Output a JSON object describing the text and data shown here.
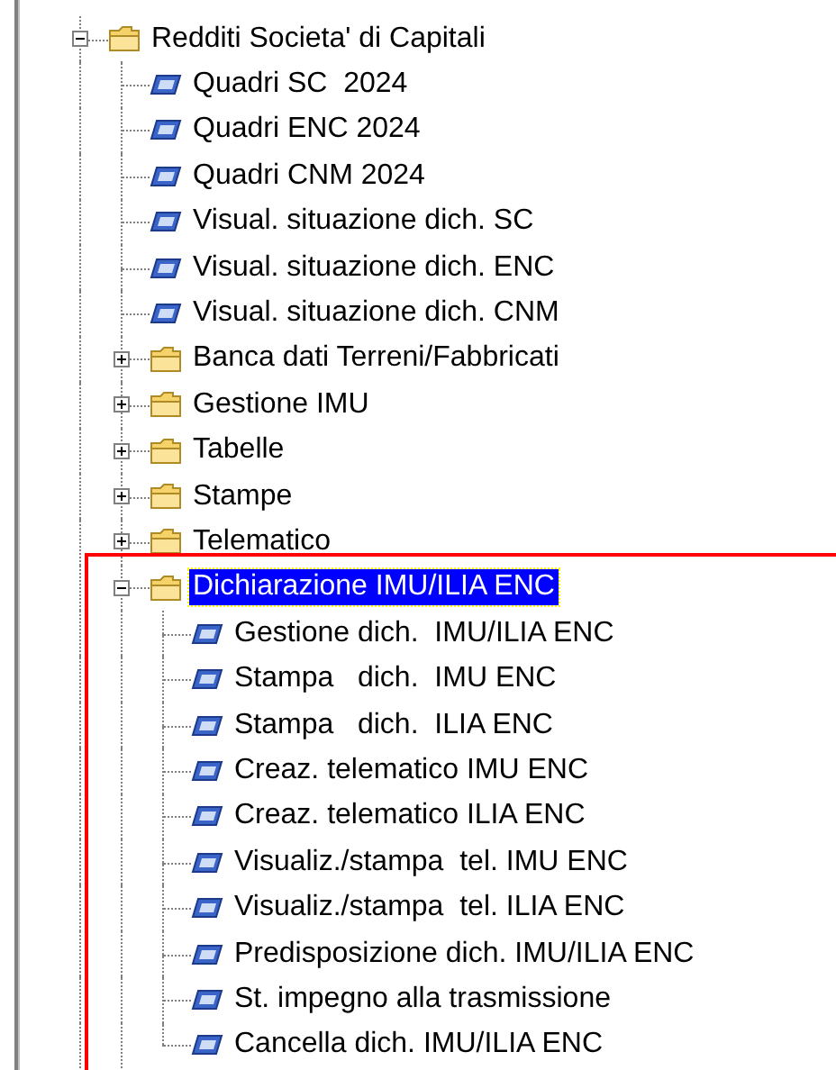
{
  "tree": [
    {
      "label": "Redditi Societa' di Capitali",
      "kind": "folder",
      "expanded": true,
      "selected": false,
      "children": [
        {
          "label": "Quadri SC  2024",
          "kind": "item",
          "selected": false
        },
        {
          "label": "Quadri ENC 2024",
          "kind": "item",
          "selected": false
        },
        {
          "label": "Quadri CNM 2024",
          "kind": "item",
          "selected": false
        },
        {
          "label": "Visual. situazione dich. SC",
          "kind": "item",
          "selected": false
        },
        {
          "label": "Visual. situazione dich. ENC",
          "kind": "item",
          "selected": false
        },
        {
          "label": "Visual. situazione dich. CNM",
          "kind": "item",
          "selected": false
        },
        {
          "label": "Banca dati Terreni/Fabbricati",
          "kind": "folder",
          "expanded": false,
          "selected": false
        },
        {
          "label": "Gestione IMU",
          "kind": "folder",
          "expanded": false,
          "selected": false
        },
        {
          "label": "Tabelle",
          "kind": "folder",
          "expanded": false,
          "selected": false
        },
        {
          "label": "Stampe",
          "kind": "folder",
          "expanded": false,
          "selected": false
        },
        {
          "label": "Telematico",
          "kind": "folder",
          "expanded": false,
          "selected": false
        },
        {
          "label": "Dichiarazione IMU/ILIA ENC",
          "kind": "folder",
          "expanded": true,
          "selected": true,
          "children": [
            {
              "label": "Gestione dich.  IMU/ILIA ENC",
              "kind": "item",
              "selected": false
            },
            {
              "label": "Stampa   dich.  IMU ENC",
              "kind": "item",
              "selected": false
            },
            {
              "label": "Stampa   dich.  ILIA ENC",
              "kind": "item",
              "selected": false
            },
            {
              "label": "Creaz. telematico IMU ENC",
              "kind": "item",
              "selected": false
            },
            {
              "label": "Creaz. telematico ILIA ENC",
              "kind": "item",
              "selected": false
            },
            {
              "label": "Visualiz./stampa  tel. IMU ENC",
              "kind": "item",
              "selected": false
            },
            {
              "label": "Visualiz./stampa  tel. ILIA ENC",
              "kind": "item",
              "selected": false
            },
            {
              "label": "Predisposizione dich. IMU/ILIA ENC",
              "kind": "item",
              "selected": false
            },
            {
              "label": "St. impegno alla trasmissione",
              "kind": "item",
              "selected": false
            },
            {
              "label": "Cancella dich. IMU/ILIA ENC",
              "kind": "item",
              "selected": false
            }
          ]
        }
      ]
    }
  ]
}
